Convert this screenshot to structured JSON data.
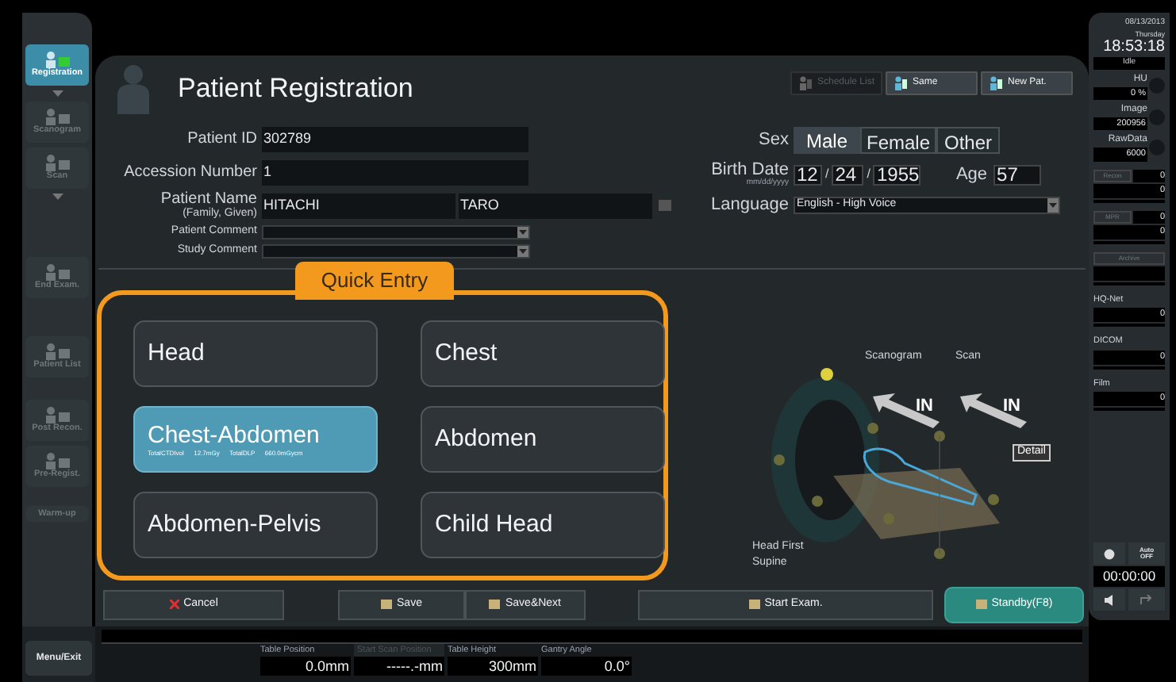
{
  "sidebar": {
    "items": [
      {
        "label": "Registration",
        "selected": true,
        "disabled": false,
        "caret_after": true
      },
      {
        "label": "Scanogram",
        "selected": false,
        "disabled": true,
        "caret_after": false
      },
      {
        "label": "Scan",
        "selected": false,
        "disabled": true,
        "caret_after": true
      },
      {
        "label": "End Exam.",
        "selected": false,
        "disabled": true,
        "caret_after": false
      },
      {
        "label": "Patient List",
        "selected": false,
        "disabled": true,
        "caret_after": false
      },
      {
        "label": "Post Recon.",
        "selected": false,
        "disabled": true,
        "caret_after": false
      },
      {
        "label": "Pre-Regist.",
        "selected": false,
        "disabled": true,
        "caret_after": false
      },
      {
        "label": "Warm-up",
        "selected": false,
        "disabled": true,
        "caret_after": false
      }
    ],
    "menu_button": "Menu/Exit"
  },
  "registration": {
    "title": "Patient Registration",
    "toolbar": [
      {
        "label": "Schedule List",
        "disabled": true
      },
      {
        "label": "Same",
        "disabled": false
      },
      {
        "label": "New Pat.",
        "disabled": false
      }
    ],
    "patient_id": {
      "label": "Patient ID",
      "value": "302789"
    },
    "accession_number": {
      "label": "Accession Number",
      "value": "1"
    },
    "patient_name": {
      "label": "Patient Name",
      "sublabel": "(Family, Given)",
      "family": "HITACHI",
      "given": "TARO"
    },
    "patient_comment": {
      "label": "Patient Comment"
    },
    "study_comment": {
      "label": "Study Comment"
    },
    "sex": {
      "label": "Sex",
      "options": [
        {
          "label": "Male",
          "selected": true
        },
        {
          "label": "Female",
          "selected": false
        },
        {
          "label": "Other",
          "selected": false
        }
      ]
    },
    "birth_date": {
      "label": "Birth Date",
      "hint": "mm/dd/yyyy",
      "month": "12",
      "day": "24",
      "year": "1955",
      "separator": "/"
    },
    "age": {
      "label": "Age",
      "value": "57"
    },
    "language": {
      "label": "Language",
      "value": "English - High Voice"
    }
  },
  "quick_entry": {
    "title": "Quick Entry",
    "buttons": [
      {
        "label": "Head",
        "selected": false
      },
      {
        "label": "Chest",
        "selected": false
      },
      {
        "label": "Chest-Abdomen",
        "selected": true,
        "details": [
          "TotalCTDIvol",
          "12.7mGy",
          "TotalDLP",
          "660.0mGycm"
        ]
      },
      {
        "label": "Abdomen",
        "selected": false
      },
      {
        "label": "Abdomen-Pelvis",
        "selected": false
      },
      {
        "label": "Child Head",
        "selected": false
      }
    ]
  },
  "positioning": {
    "directions": [
      {
        "label": "Scanogram",
        "arrow": "IN"
      },
      {
        "label": "Scan",
        "arrow": "IN"
      }
    ],
    "detail_button": "Detail",
    "orientation": [
      "Head First",
      "Supine"
    ]
  },
  "actions": [
    {
      "kind": "cancel",
      "label": "Cancel"
    },
    {
      "kind": "save",
      "label": "Save"
    },
    {
      "kind": "save_next",
      "label": "Save&Next"
    },
    {
      "kind": "start",
      "label": "Start Exam."
    },
    {
      "kind": "standby",
      "label": "Standby(F8)"
    }
  ],
  "status_strip": [
    {
      "label": "Table Position",
      "value": "0.0mm",
      "disabled": false
    },
    {
      "label": "Start Scan Position",
      "value": "-----.-mm",
      "disabled": true
    },
    {
      "label": "Table Height",
      "value": "300mm",
      "disabled": false
    },
    {
      "label": "Gantry Angle",
      "value": "0.0°",
      "disabled": false
    }
  ],
  "status_panel": {
    "date": "08/13/2013",
    "weekday": "Thursday",
    "time": "18:53:18",
    "state": "Idle",
    "meters": [
      {
        "label": "HU",
        "value": "0 %"
      },
      {
        "label": "Image",
        "value": "200956"
      },
      {
        "label": "RawData",
        "value": "6000"
      }
    ],
    "queues": [
      {
        "kind": "button",
        "label": "Recon",
        "count": "0",
        "value": "0"
      },
      {
        "kind": "button",
        "label": "MPR",
        "count": "0",
        "value": "0"
      },
      {
        "kind": "button",
        "label": "Archive"
      },
      {
        "kind": "label",
        "label": "HQ-Net",
        "value": "0"
      },
      {
        "kind": "label",
        "label": "DICOM",
        "value": "0"
      },
      {
        "kind": "label",
        "label": "Film",
        "value": "0"
      }
    ],
    "auto_button": [
      "Auto",
      "OFF"
    ],
    "timer": "00:00:00"
  }
}
